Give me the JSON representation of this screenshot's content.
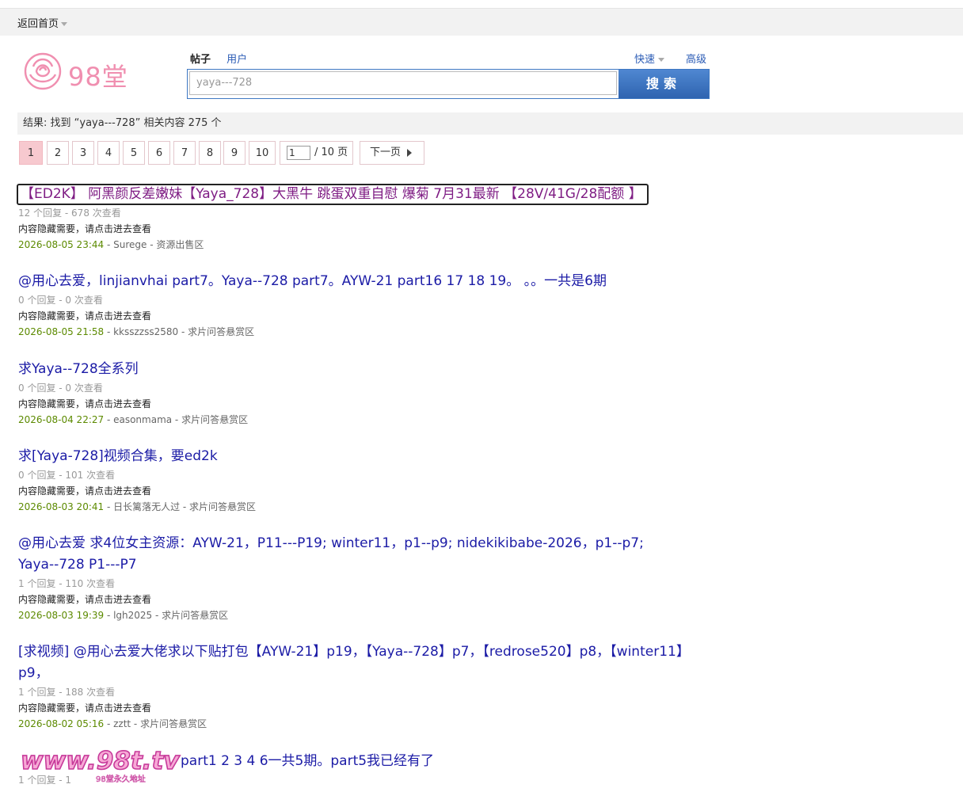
{
  "topbar": {
    "home_label": "返回首页"
  },
  "logo": {
    "text": "98堂"
  },
  "search": {
    "tab_posts": "帖子",
    "tab_users": "用户",
    "quick_label": "快速",
    "advanced_label": "高级",
    "query": "yaya---728",
    "button_label": "搜索"
  },
  "result_summary": "结果: 找到 “yaya---728” 相关内容 275 个",
  "pager": {
    "pages": [
      "1",
      "2",
      "3",
      "4",
      "5",
      "6",
      "7",
      "8",
      "9",
      "10"
    ],
    "current": "1",
    "jump_value": "1",
    "total_label": "/ 10 页",
    "next_label": "下一页"
  },
  "results": [
    {
      "title": "【ED2K】 阿黑颜反差嫩妹【Yaya_728】大黑牛 跳蛋双重自慰 爆菊 7月31最新 【28V/41G/28配额 】",
      "meta": "12 个回复 - 678 次查看",
      "desc": "内容隐藏需要，请点击进去查看",
      "date": "2026-08-05 23:44",
      "info_rest": " - Surege - 资源出售区"
    },
    {
      "title": "@用心去爱，linjianvhai part7。Yaya--728 part7。AYW-21 part16 17 18 19。 。。一共是6期",
      "meta": "0 个回复 - 0 次查看",
      "desc": "内容隐藏需要，请点击进去查看",
      "date": "2026-08-05 21:58",
      "info_rest": " - kksszzss2580 - 求片问答悬赏区"
    },
    {
      "title": "求Yaya--728全系列",
      "meta": "0 个回复 - 0 次查看",
      "desc": "内容隐藏需要，请点击进去查看",
      "date": "2026-08-04 22:27",
      "info_rest": " - easonmama - 求片问答悬赏区"
    },
    {
      "title": "求[Yaya-728]视频合集，要ed2k",
      "meta": "0 个回复 - 101 次查看",
      "desc": "内容隐藏需要，请点击进去查看",
      "date": "2026-08-03 20:41",
      "info_rest": " - 日长篱落无人过 - 求片问答悬赏区"
    },
    {
      "title": "@用心去爱 求4位女主资源：AYW-21，P11---P19; winter11，p1--p9; nidekikibabe-2026，p1--p7; Yaya--728 P1---P7",
      "meta": "1 个回复 - 110 次查看",
      "desc": "内容隐藏需要，请点击进去查看",
      "date": "2026-08-03 19:39",
      "info_rest": " - lgh2025 - 求片问答悬赏区"
    },
    {
      "title": "[求视频] @用心去爱大佬求以下贴打包【AYW-21】p19，【Yaya--728】p7，【redrose520】p8，【winter11】p9，",
      "meta": "1 个回复 - 188 次查看",
      "desc": "内容隐藏需要，请点击进去查看",
      "date": "2026-08-02 05:16",
      "info_rest": " - zztt - 求片问答悬赏区"
    },
    {
      "title": "part1 2 3 4 6一共5期。part5我已经有了",
      "meta": "1 个回复 - 1",
      "desc": "",
      "date": "",
      "info_rest": ""
    }
  ],
  "watermark": {
    "text": "www.98t.tv",
    "subtext": "98堂永久地址"
  }
}
